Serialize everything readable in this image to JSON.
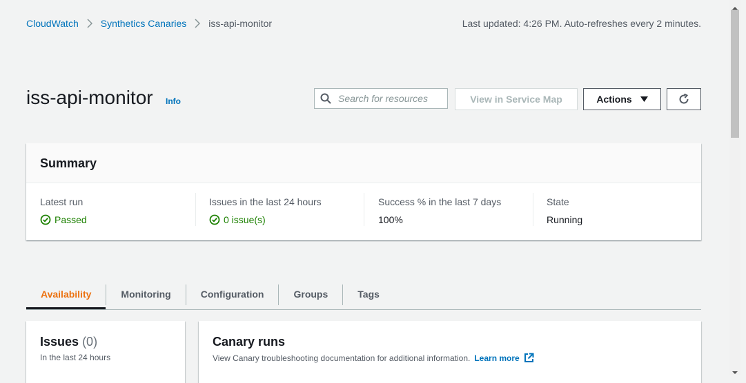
{
  "breadcrumb": {
    "items": [
      "CloudWatch",
      "Synthetics Canaries"
    ],
    "current": "iss-api-monitor"
  },
  "last_updated": "Last updated: 4:26 PM. Auto-refreshes every 2 minutes.",
  "header": {
    "title": "iss-api-monitor",
    "info_label": "Info",
    "search_placeholder": "Search for resources",
    "view_map_label": "View in Service Map",
    "actions_label": "Actions"
  },
  "summary": {
    "title": "Summary",
    "columns": [
      {
        "label": "Latest run",
        "value": "Passed"
      },
      {
        "label": "Issues in the last 24 hours",
        "value": "0 issue(s)"
      },
      {
        "label": "Success % in the last 7 days",
        "value": "100%"
      },
      {
        "label": "State",
        "value": "Running"
      }
    ]
  },
  "tabs": [
    "Availability",
    "Monitoring",
    "Configuration",
    "Groups",
    "Tags"
  ],
  "issues_panel": {
    "title": "Issues",
    "count": "(0)",
    "subtitle": "In the last 24 hours"
  },
  "runs_panel": {
    "title": "Canary runs",
    "description": "View Canary troubleshooting documentation for additional information.",
    "learn_more": "Learn more"
  },
  "colors": {
    "link": "#0073bb",
    "success": "#1d8102",
    "active_tab": "#ec7211",
    "background": "#f2f3f3"
  }
}
